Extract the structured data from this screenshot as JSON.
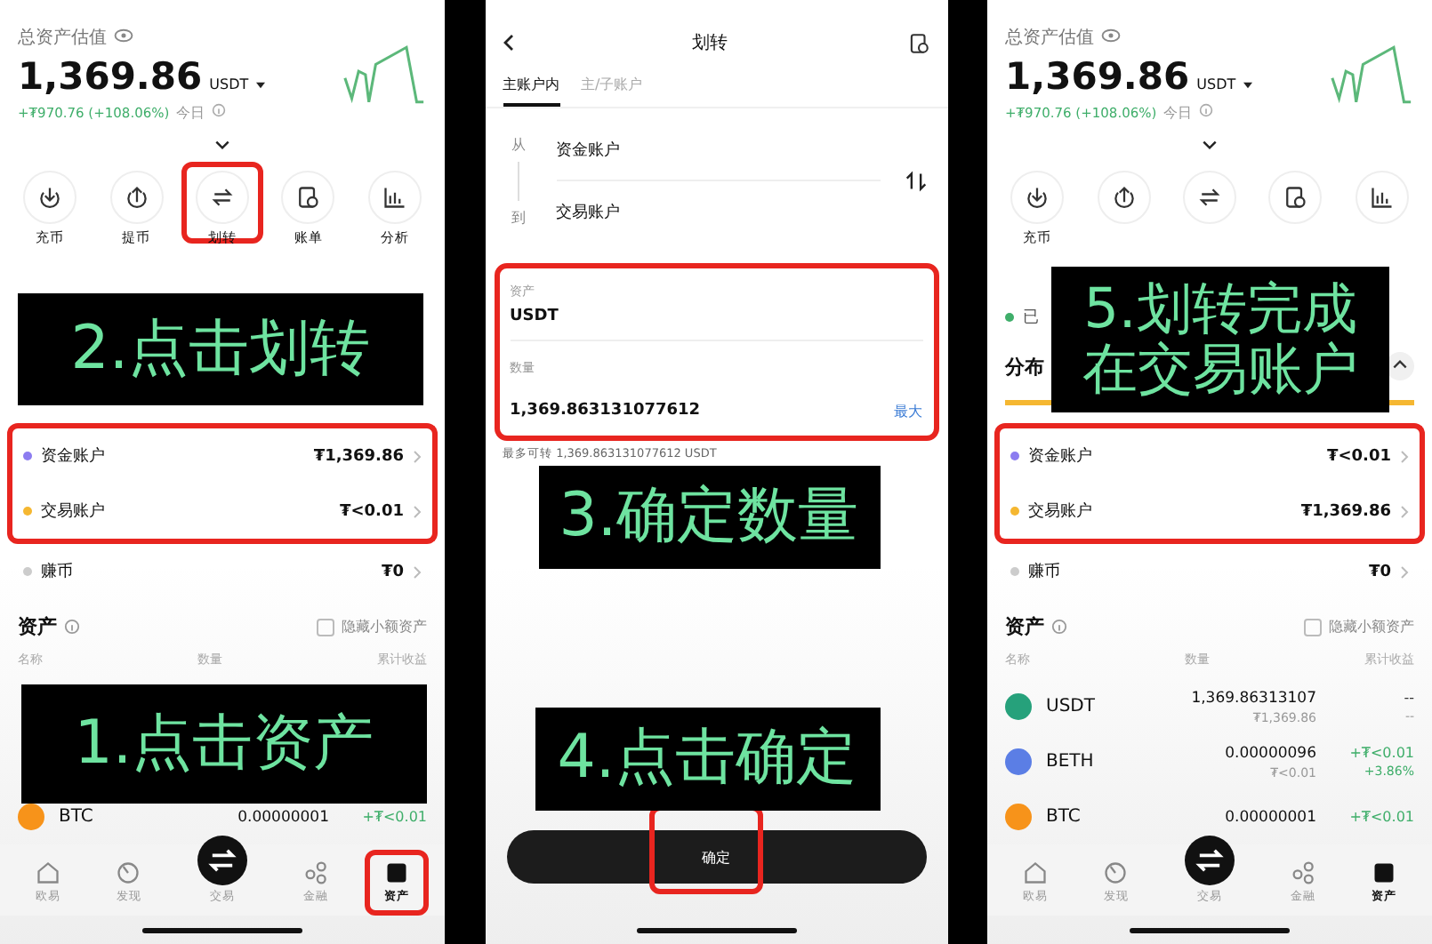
{
  "panels": [
    {
      "kind": "assets",
      "total_label": "总资产估值",
      "total": "1,369.86",
      "unit": "USDT",
      "change": "+₮970.76 (+108.06%)",
      "period": "今日",
      "actions": [
        {
          "label": "充币",
          "highlighted": false
        },
        {
          "label": "提币",
          "highlighted": false
        },
        {
          "label": "划转",
          "highlighted": true
        },
        {
          "label": "账单",
          "highlighted": false
        },
        {
          "label": "分析",
          "highlighted": false
        }
      ],
      "accounts": [
        {
          "name": "资金账户",
          "amount": "₮1,369.86",
          "color": "#8c7cf0",
          "highlighted": true
        },
        {
          "name": "交易账户",
          "amount": "₮<0.01",
          "color": "#f5b731",
          "highlighted": true
        },
        {
          "name": "赚币",
          "amount": "₮0",
          "color": "#cccccc",
          "highlighted": false
        }
      ],
      "assets_title": "资产",
      "hide_small": {
        "label": "隐藏小额资产",
        "checked": false
      },
      "columns": [
        "名称",
        "数量",
        "累计收益"
      ],
      "assets": [
        {
          "coin": "BTC",
          "color": "#f7931a",
          "amount": "0.00000001",
          "gain": "+₮<0.01",
          "positive": true
        }
      ],
      "nav": [
        {
          "label": "欧易",
          "selected": false,
          "highlighted": false
        },
        {
          "label": "发现",
          "selected": false,
          "highlighted": false
        },
        {
          "label": "交易",
          "selected": false,
          "highlighted": false
        },
        {
          "label": "金融",
          "selected": false,
          "highlighted": false
        },
        {
          "label": "资产",
          "selected": true,
          "highlighted": true
        }
      ],
      "captions": [
        {
          "lines": [
            "2.点击划转"
          ]
        },
        {
          "lines": [
            "1.点击资产"
          ]
        }
      ]
    },
    {
      "kind": "transfer",
      "title": "划转",
      "tabs": [
        {
          "label": "主账户内",
          "selected": true
        },
        {
          "label": "主/子账户",
          "selected": false
        }
      ],
      "from_label": "从",
      "from": "资金账户",
      "to_label": "到",
      "to": "交易账户",
      "asset_label": "资产",
      "asset": "USDT",
      "amount_label": "数量",
      "amount": "1,369.863131077612",
      "max": "最大",
      "available": "最多可转 1,369.863131077612 USDT",
      "fields_highlighted": true,
      "confirm": {
        "label": "确定",
        "highlighted": true
      },
      "captions": [
        {
          "lines": [
            "3.确定数量"
          ]
        },
        {
          "lines": [
            "4.点击确定"
          ]
        }
      ]
    },
    {
      "kind": "assets",
      "total_label": "总资产估值",
      "total": "1,369.86",
      "unit": "USDT",
      "change": "+₮970.76 (+108.06%)",
      "period": "今日",
      "actions": [
        {
          "label": "充币",
          "highlighted": false
        },
        {
          "highlighted": false
        },
        {
          "highlighted": false
        },
        {
          "highlighted": false
        },
        {
          "highlighted": false
        }
      ],
      "notice": "已",
      "distribution": {
        "title": "分布",
        "expanded": true
      },
      "accounts": [
        {
          "name": "资金账户",
          "amount": "₮<0.01",
          "color": "#8c7cf0",
          "highlighted": true
        },
        {
          "name": "交易账户",
          "amount": "₮1,369.86",
          "color": "#f5b731",
          "highlighted": true
        },
        {
          "name": "赚币",
          "amount": "₮0",
          "color": "#cccccc",
          "highlighted": false
        }
      ],
      "assets_title": "资产",
      "hide_small": {
        "label": "隐藏小额资产",
        "checked": false
      },
      "columns": [
        "名称",
        "数量",
        "累计收益"
      ],
      "assets": [
        {
          "coin": "USDT",
          "color": "#26a17b",
          "amount": "1,369.86313107",
          "value": "₮1,369.86",
          "gain": "--",
          "gain_sub": "--",
          "positive": false
        },
        {
          "coin": "BETH",
          "color": "#5b7ee5",
          "amount": "0.00000096",
          "value": "₮<0.01",
          "gain": "+₮<0.01",
          "gain_sub": "+3.86%",
          "positive": true
        },
        {
          "coin": "BTC",
          "color": "#f7931a",
          "amount": "0.00000001",
          "gain": "+₮<0.01",
          "positive": true
        }
      ],
      "nav": [
        {
          "label": "欧易",
          "selected": false,
          "highlighted": false
        },
        {
          "label": "发现",
          "selected": false,
          "highlighted": false
        },
        {
          "label": "交易",
          "selected": false,
          "highlighted": false
        },
        {
          "label": "金融",
          "selected": false,
          "highlighted": false
        },
        {
          "label": "资产",
          "selected": true,
          "highlighted": false
        }
      ],
      "captions": [
        {
          "lines": [
            "5.划转完成",
            "在交易账户"
          ]
        }
      ]
    }
  ]
}
